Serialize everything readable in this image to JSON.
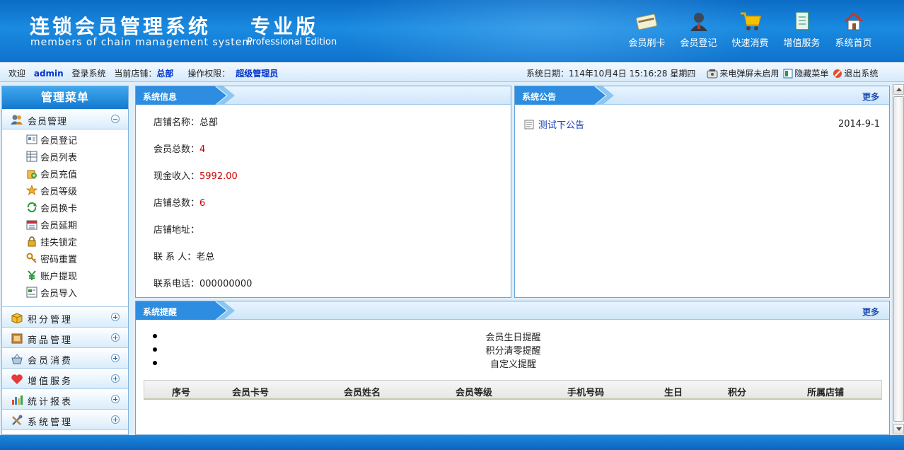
{
  "header": {
    "title": "连锁会员管理系统",
    "edition": "专业版",
    "subtitle": "members of chain management system",
    "subtitle_edition": "Professional Edition",
    "nav": [
      {
        "label": "会员刷卡",
        "icon": "card-icon"
      },
      {
        "label": "会员登记",
        "icon": "user-icon"
      },
      {
        "label": "快速消费",
        "icon": "cart-icon"
      },
      {
        "label": "增值服务",
        "icon": "document-icon"
      },
      {
        "label": "系统首页",
        "icon": "home-icon"
      }
    ]
  },
  "infobar": {
    "welcome": "欢迎",
    "user": "admin",
    "login_text": "登录系统",
    "store_label": "当前店铺：",
    "store": "总部",
    "perm_label": "操作权限：",
    "perm": "超级管理员",
    "date_text": "系统日期：114年10月4日 15:16:28 星期四",
    "popup_link": "来电弹屏未启用",
    "hide_menu": "隐藏菜单",
    "logout": "退出系统"
  },
  "sidebar": {
    "title": "管理菜单",
    "expanded": {
      "label": "会员管理",
      "icon": "users-icon",
      "items": [
        {
          "label": "会员登记",
          "icon": "register-icon"
        },
        {
          "label": "会员列表",
          "icon": "list-icon"
        },
        {
          "label": "会员充值",
          "icon": "recharge-icon"
        },
        {
          "label": "会员等级",
          "icon": "level-icon"
        },
        {
          "label": "会员换卡",
          "icon": "swap-icon"
        },
        {
          "label": "会员延期",
          "icon": "calendar-icon"
        },
        {
          "label": "挂失锁定",
          "icon": "lock-icon"
        },
        {
          "label": "密码重置",
          "icon": "key-icon"
        },
        {
          "label": "账户提现",
          "icon": "yuan-icon"
        },
        {
          "label": "会员导入",
          "icon": "import-icon"
        }
      ]
    },
    "sections": [
      {
        "label": "积分管理",
        "icon": "box-icon"
      },
      {
        "label": "商品管理",
        "icon": "goods-icon"
      },
      {
        "label": "会员消费",
        "icon": "basket-icon"
      },
      {
        "label": "增值服务",
        "icon": "heart-icon"
      },
      {
        "label": "统计报表",
        "icon": "chart-icon"
      },
      {
        "label": "系统管理",
        "icon": "tools-icon"
      }
    ]
  },
  "sysinfo": {
    "title": "系统信息",
    "rows": [
      {
        "label": "店铺名称：",
        "value": "总部"
      },
      {
        "label": "会员总数：",
        "value": "4"
      },
      {
        "label": "现金收入：",
        "value": "5992.00"
      },
      {
        "label": "店铺总数：",
        "value": "6"
      },
      {
        "label": "店铺地址：",
        "value": ""
      },
      {
        "label": "联 系 人：",
        "value": "老总"
      },
      {
        "label": "联系电话：",
        "value": "000000000"
      }
    ]
  },
  "notice": {
    "title": "系统公告",
    "more": "更多",
    "items": [
      {
        "title": "测试下公告",
        "date": "2014-9-1"
      }
    ]
  },
  "remind": {
    "title": "系统提醒",
    "more": "更多",
    "items": [
      "会员生日提醒",
      "积分清零提醒",
      "自定义提醒"
    ],
    "columns": [
      "序号",
      "会员卡号",
      "会员姓名",
      "会员等级",
      "手机号码",
      "生日",
      "积分",
      "所属店铺"
    ]
  },
  "colors": {
    "header_blue": "#1a8ae0",
    "accent_red": "#cc0000",
    "link_blue": "#1f3fb0"
  }
}
